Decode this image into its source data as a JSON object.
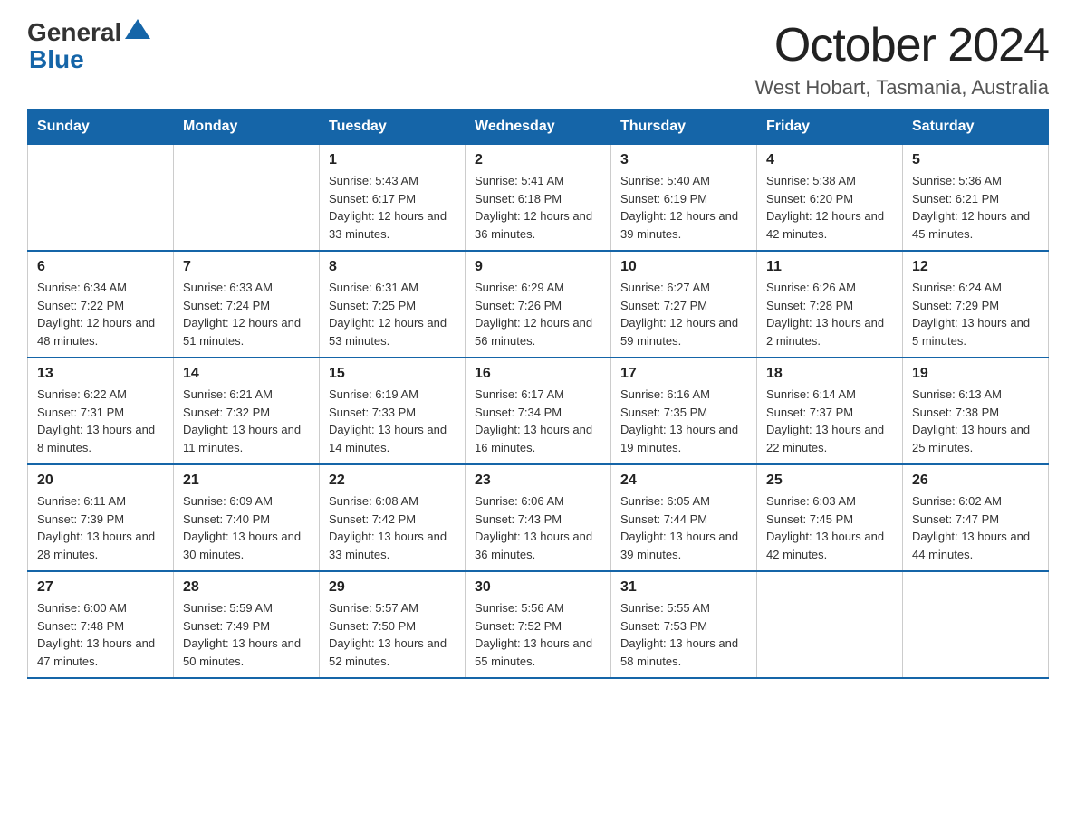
{
  "header": {
    "logo_general": "General",
    "logo_blue": "Blue",
    "title": "October 2024",
    "subtitle": "West Hobart, Tasmania, Australia"
  },
  "days_of_week": [
    "Sunday",
    "Monday",
    "Tuesday",
    "Wednesday",
    "Thursday",
    "Friday",
    "Saturday"
  ],
  "weeks": [
    [
      {
        "day": "",
        "sunrise": "",
        "sunset": "",
        "daylight": ""
      },
      {
        "day": "",
        "sunrise": "",
        "sunset": "",
        "daylight": ""
      },
      {
        "day": "1",
        "sunrise": "Sunrise: 5:43 AM",
        "sunset": "Sunset: 6:17 PM",
        "daylight": "Daylight: 12 hours and 33 minutes."
      },
      {
        "day": "2",
        "sunrise": "Sunrise: 5:41 AM",
        "sunset": "Sunset: 6:18 PM",
        "daylight": "Daylight: 12 hours and 36 minutes."
      },
      {
        "day": "3",
        "sunrise": "Sunrise: 5:40 AM",
        "sunset": "Sunset: 6:19 PM",
        "daylight": "Daylight: 12 hours and 39 minutes."
      },
      {
        "day": "4",
        "sunrise": "Sunrise: 5:38 AM",
        "sunset": "Sunset: 6:20 PM",
        "daylight": "Daylight: 12 hours and 42 minutes."
      },
      {
        "day": "5",
        "sunrise": "Sunrise: 5:36 AM",
        "sunset": "Sunset: 6:21 PM",
        "daylight": "Daylight: 12 hours and 45 minutes."
      }
    ],
    [
      {
        "day": "6",
        "sunrise": "Sunrise: 6:34 AM",
        "sunset": "Sunset: 7:22 PM",
        "daylight": "Daylight: 12 hours and 48 minutes."
      },
      {
        "day": "7",
        "sunrise": "Sunrise: 6:33 AM",
        "sunset": "Sunset: 7:24 PM",
        "daylight": "Daylight: 12 hours and 51 minutes."
      },
      {
        "day": "8",
        "sunrise": "Sunrise: 6:31 AM",
        "sunset": "Sunset: 7:25 PM",
        "daylight": "Daylight: 12 hours and 53 minutes."
      },
      {
        "day": "9",
        "sunrise": "Sunrise: 6:29 AM",
        "sunset": "Sunset: 7:26 PM",
        "daylight": "Daylight: 12 hours and 56 minutes."
      },
      {
        "day": "10",
        "sunrise": "Sunrise: 6:27 AM",
        "sunset": "Sunset: 7:27 PM",
        "daylight": "Daylight: 12 hours and 59 minutes."
      },
      {
        "day": "11",
        "sunrise": "Sunrise: 6:26 AM",
        "sunset": "Sunset: 7:28 PM",
        "daylight": "Daylight: 13 hours and 2 minutes."
      },
      {
        "day": "12",
        "sunrise": "Sunrise: 6:24 AM",
        "sunset": "Sunset: 7:29 PM",
        "daylight": "Daylight: 13 hours and 5 minutes."
      }
    ],
    [
      {
        "day": "13",
        "sunrise": "Sunrise: 6:22 AM",
        "sunset": "Sunset: 7:31 PM",
        "daylight": "Daylight: 13 hours and 8 minutes."
      },
      {
        "day": "14",
        "sunrise": "Sunrise: 6:21 AM",
        "sunset": "Sunset: 7:32 PM",
        "daylight": "Daylight: 13 hours and 11 minutes."
      },
      {
        "day": "15",
        "sunrise": "Sunrise: 6:19 AM",
        "sunset": "Sunset: 7:33 PM",
        "daylight": "Daylight: 13 hours and 14 minutes."
      },
      {
        "day": "16",
        "sunrise": "Sunrise: 6:17 AM",
        "sunset": "Sunset: 7:34 PM",
        "daylight": "Daylight: 13 hours and 16 minutes."
      },
      {
        "day": "17",
        "sunrise": "Sunrise: 6:16 AM",
        "sunset": "Sunset: 7:35 PM",
        "daylight": "Daylight: 13 hours and 19 minutes."
      },
      {
        "day": "18",
        "sunrise": "Sunrise: 6:14 AM",
        "sunset": "Sunset: 7:37 PM",
        "daylight": "Daylight: 13 hours and 22 minutes."
      },
      {
        "day": "19",
        "sunrise": "Sunrise: 6:13 AM",
        "sunset": "Sunset: 7:38 PM",
        "daylight": "Daylight: 13 hours and 25 minutes."
      }
    ],
    [
      {
        "day": "20",
        "sunrise": "Sunrise: 6:11 AM",
        "sunset": "Sunset: 7:39 PM",
        "daylight": "Daylight: 13 hours and 28 minutes."
      },
      {
        "day": "21",
        "sunrise": "Sunrise: 6:09 AM",
        "sunset": "Sunset: 7:40 PM",
        "daylight": "Daylight: 13 hours and 30 minutes."
      },
      {
        "day": "22",
        "sunrise": "Sunrise: 6:08 AM",
        "sunset": "Sunset: 7:42 PM",
        "daylight": "Daylight: 13 hours and 33 minutes."
      },
      {
        "day": "23",
        "sunrise": "Sunrise: 6:06 AM",
        "sunset": "Sunset: 7:43 PM",
        "daylight": "Daylight: 13 hours and 36 minutes."
      },
      {
        "day": "24",
        "sunrise": "Sunrise: 6:05 AM",
        "sunset": "Sunset: 7:44 PM",
        "daylight": "Daylight: 13 hours and 39 minutes."
      },
      {
        "day": "25",
        "sunrise": "Sunrise: 6:03 AM",
        "sunset": "Sunset: 7:45 PM",
        "daylight": "Daylight: 13 hours and 42 minutes."
      },
      {
        "day": "26",
        "sunrise": "Sunrise: 6:02 AM",
        "sunset": "Sunset: 7:47 PM",
        "daylight": "Daylight: 13 hours and 44 minutes."
      }
    ],
    [
      {
        "day": "27",
        "sunrise": "Sunrise: 6:00 AM",
        "sunset": "Sunset: 7:48 PM",
        "daylight": "Daylight: 13 hours and 47 minutes."
      },
      {
        "day": "28",
        "sunrise": "Sunrise: 5:59 AM",
        "sunset": "Sunset: 7:49 PM",
        "daylight": "Daylight: 13 hours and 50 minutes."
      },
      {
        "day": "29",
        "sunrise": "Sunrise: 5:57 AM",
        "sunset": "Sunset: 7:50 PM",
        "daylight": "Daylight: 13 hours and 52 minutes."
      },
      {
        "day": "30",
        "sunrise": "Sunrise: 5:56 AM",
        "sunset": "Sunset: 7:52 PM",
        "daylight": "Daylight: 13 hours and 55 minutes."
      },
      {
        "day": "31",
        "sunrise": "Sunrise: 5:55 AM",
        "sunset": "Sunset: 7:53 PM",
        "daylight": "Daylight: 13 hours and 58 minutes."
      },
      {
        "day": "",
        "sunrise": "",
        "sunset": "",
        "daylight": ""
      },
      {
        "day": "",
        "sunrise": "",
        "sunset": "",
        "daylight": ""
      }
    ]
  ]
}
